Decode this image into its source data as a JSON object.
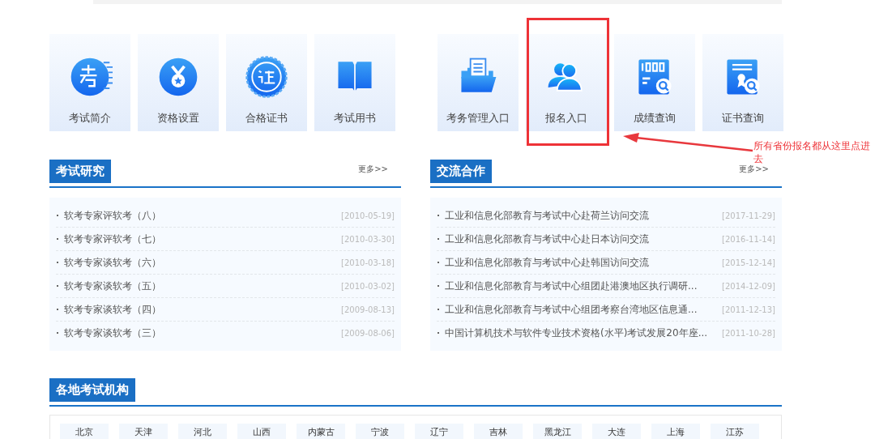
{
  "tiles_left": [
    {
      "label": "考试简介",
      "kind": "kao"
    },
    {
      "label": "资格设置",
      "kind": "medal"
    },
    {
      "label": "合格证书",
      "kind": "seal"
    },
    {
      "label": "考试用书",
      "kind": "book"
    }
  ],
  "tiles_right": [
    {
      "label": "考务管理入口",
      "kind": "folder",
      "highlighted": false
    },
    {
      "label": "报名入口",
      "kind": "users",
      "highlighted": true
    },
    {
      "label": "成绩查询",
      "kind": "score",
      "highlighted": false
    },
    {
      "label": "证书查询",
      "kind": "cert",
      "highlighted": false
    }
  ],
  "annotation": {
    "text": "所有省份报名都从这里点进去"
  },
  "sections": [
    {
      "title": "考试研究",
      "more": "更多>>",
      "items": [
        {
          "title": "软考专家评软考（八）",
          "date": "[2010-05-19]"
        },
        {
          "title": "软考专家评软考（七）",
          "date": "[2010-03-30]"
        },
        {
          "title": "软考专家谈软考（六）",
          "date": "[2010-03-18]"
        },
        {
          "title": "软考专家谈软考（五）",
          "date": "[2010-03-02]"
        },
        {
          "title": "软考专家谈软考（四）",
          "date": "[2009-08-13]"
        },
        {
          "title": "软考专家谈软考（三）",
          "date": "[2009-08-06]"
        }
      ]
    },
    {
      "title": "交流合作",
      "more": "更多>>",
      "items": [
        {
          "title": "工业和信息化部教育与考试中心赴荷兰访问交流",
          "date": "[2017-11-29]"
        },
        {
          "title": "工业和信息化部教育与考试中心赴日本访问交流",
          "date": "[2016-11-14]"
        },
        {
          "title": "工业和信息化部教育与考试中心赴韩国访问交流",
          "date": "[2015-12-14]"
        },
        {
          "title": "工业和信息化部教育与考试中心组团赴港澳地区执行调研...",
          "date": "[2014-12-09]"
        },
        {
          "title": "工业和信息化部教育与考试中心组团考察台湾地区信息通...",
          "date": "[2011-12-13]"
        },
        {
          "title": "中国计算机技术与软件专业技术资格(水平)考试发展20年座...",
          "date": "[2011-10-28]"
        }
      ]
    }
  ],
  "regions": {
    "title": "各地考试机构",
    "items": [
      "北京",
      "天津",
      "河北",
      "山西",
      "内蒙古",
      "宁波",
      "辽宁",
      "吉林",
      "黑龙江",
      "大连",
      "上海",
      "江苏"
    ]
  }
}
